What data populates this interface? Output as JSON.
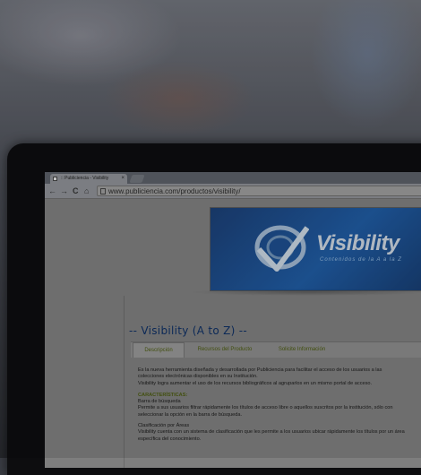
{
  "browser": {
    "tab_title": ":: Publiciencia - Visibility",
    "tab_close": "×",
    "back": "←",
    "forward": "→",
    "reload": "C",
    "home": "⌂",
    "url": "www.publiciencia.com/productos/visibility/"
  },
  "banner": {
    "logo_text": "Visibility",
    "tagline": "Contenidos de la A a la Z"
  },
  "page": {
    "heading": "-- Visibility (A to Z) --",
    "tabs": [
      {
        "label": "Descripción"
      },
      {
        "label": "Recursos del Producto"
      },
      {
        "label": "Solicite Información"
      }
    ],
    "intro1": "Es la nueva herramienta diseñada y desarrollada por Publiciencia para facilitar el acceso de los usuarios a las colecciones electrónicas disponibles en su Institución.",
    "intro2": "Visibility logra aumentar el uso de los recursos bibliográficos al agruparlos en un mismo portal de acceso.",
    "features_title": "CARACTERÍSTICAS:",
    "f1_title": "Barra de búsqueda",
    "f1_text": "Permite a sus usuarios filtrar rápidamente los títulos de acceso libre o aquellos suscritos por la institución, sólo con seleccionar la opción en la barra de búsqueda.",
    "f2_title": "Clasificación por Áreas",
    "f2_text": "Visibility cuenta con un sistema de clasificación que les permite a los usuarios ubicar rápidamente los títulos por un área específica del conocimiento."
  }
}
